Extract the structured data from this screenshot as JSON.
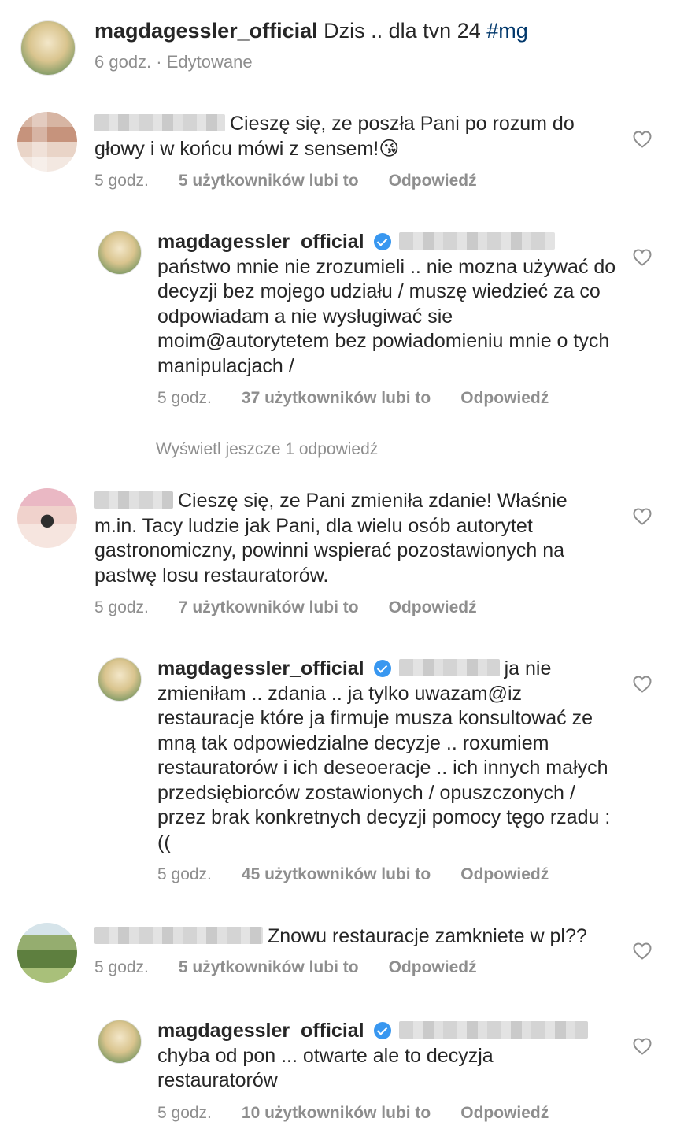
{
  "post": {
    "username": "magdagessler_official",
    "caption": "Dzis .. dla tvn 24",
    "hashtag": "#mg",
    "time": "6 godz.",
    "separator": "·",
    "edited": "Edytowane"
  },
  "comments": [
    {
      "text_line1": "Cieszę się, ze poszła Pani po rozum do",
      "text_rest": "głowy i w końcu mówi z sensem!",
      "emoji": "😘",
      "time": "5 godz.",
      "likes": "5 użytkowników lubi to",
      "reply": "Odpowiedź"
    },
    {
      "username": "magdagessler_official",
      "text": "państwo mnie nie zrozumieli .. nie mozna używać do decyzji bez mojego udziału / muszę wiedzieć za co odpowiadam a nie wysługiwać sie moim@autorytetem bez powiadomieniu mnie o tych manipulacjach /",
      "time": "5 godz.",
      "likes": "37 użytkowników lubi to",
      "reply": "Odpowiedź"
    },
    {
      "text_line1": "Cieszę się, ze Pani zmieniła zdanie! Właśnie",
      "text_rest": "m.in. Tacy ludzie jak Pani, dla wielu osób autorytet gastronomiczny, powinni wspierać pozostawionych na pastwę losu restauratorów.",
      "time": "5 godz.",
      "likes": "7 użytkowników lubi to",
      "reply": "Odpowiedź"
    },
    {
      "username": "magdagessler_official",
      "text_line1_tail": "ja nie",
      "text_rest": "zmieniłam .. zdania .. ja tylko uwazam@iz restauracje które ja firmuje musza konsultować ze mną tak odpowiedzialne decyzje .. roxumiem restauratorów i ich deseoeracje .. ich innych małych przedsiębiorców zostawionych / opuszczonych / przez  brak konkretnych decyzji pomocy tęgo rzadu :((",
      "time": "5 godz.",
      "likes": "45 użytkowników lubi to",
      "reply": "Odpowiedź"
    },
    {
      "text": "Znowu restauracje zamkniete w pl??",
      "time": "5 godz.",
      "likes": "5 użytkowników lubi to",
      "reply": "Odpowiedź"
    },
    {
      "username": "magdagessler_official",
      "text": "chyba od pon ... otwarte ale to decyzja restauratorów",
      "time": "5 godz.",
      "likes": "10 użytkowników lubi to",
      "reply": "Odpowiedź"
    }
  ],
  "view_more": "Wyświetl jeszcze 1 odpowiedź",
  "icons": {
    "heart": "heart-icon",
    "verified": "verified-badge-icon"
  },
  "colors": {
    "text": "#262626",
    "secondary": "#8e8e8e",
    "hashtag": "#00376b",
    "verified": "#3897f0"
  }
}
